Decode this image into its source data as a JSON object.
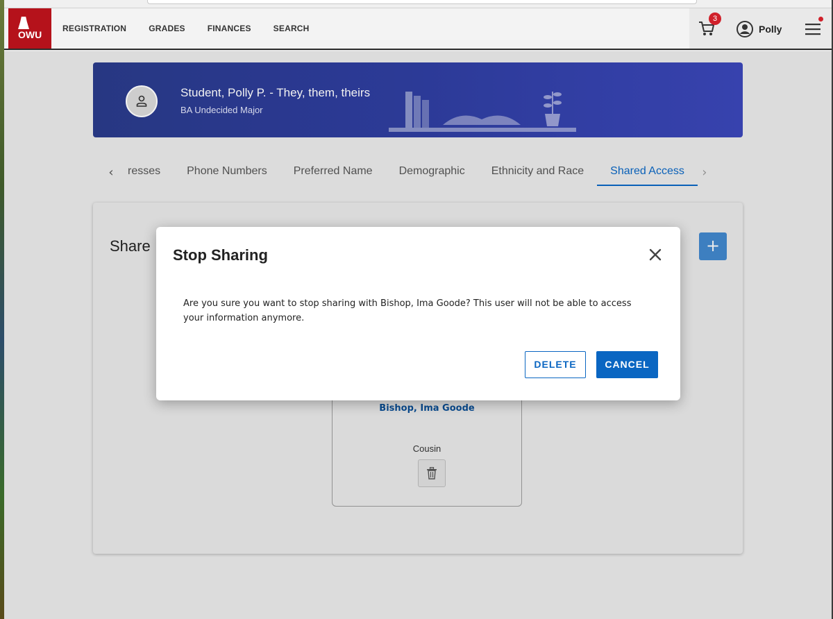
{
  "header": {
    "logo_text": "OWU",
    "nav": [
      "REGISTRATION",
      "GRADES",
      "FINANCES",
      "SEARCH"
    ],
    "cart_count": "3",
    "user_name": "Polly"
  },
  "banner": {
    "student_name": "Student, Polly P. - They, them, theirs",
    "major": "BA Undecided Major"
  },
  "tabs": {
    "items": [
      "resses",
      "Phone Numbers",
      "Preferred Name",
      "Demographic",
      "Ethnicity and Race",
      "Shared Access"
    ],
    "active": "Shared Access"
  },
  "card": {
    "title": "Share",
    "add_label": "+",
    "person": {
      "name": "Bishop, Ima Goode",
      "relationship": "Cousin"
    }
  },
  "modal": {
    "title": "Stop Sharing",
    "body": "Are you sure you want to stop sharing with Bishop, Ima Goode? This user will not be able to access your information anymore.",
    "delete_label": "DELETE",
    "cancel_label": "CANCEL"
  },
  "colors": {
    "brand_red": "#b5121b",
    "accent_blue": "#0a66c2",
    "banner_blue": "#2f3ea0"
  }
}
